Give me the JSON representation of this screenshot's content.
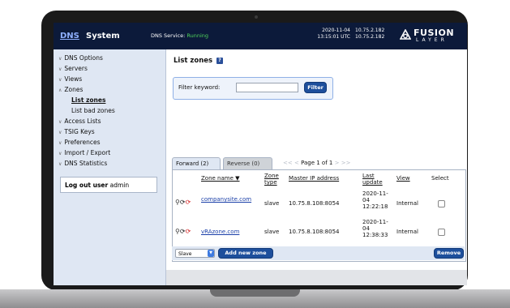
{
  "header": {
    "brand_dns": "DNS",
    "brand_system": "System",
    "service_label": "DNS Service:",
    "service_status": "Running",
    "date": "2020-11-04",
    "time": "13:15:01 UTC",
    "ip_1": "10.75.2.182",
    "ip_2": "10.75.2.182",
    "logo_word": "FUSION",
    "logo_sub": "LAYER"
  },
  "sidebar": {
    "items": [
      {
        "label": "DNS Options"
      },
      {
        "label": "Servers"
      },
      {
        "label": "Views"
      },
      {
        "label": "Zones"
      },
      {
        "label": "List zones"
      },
      {
        "label": "List bad zones"
      },
      {
        "label": "Access Lists"
      },
      {
        "label": "TSIG Keys"
      },
      {
        "label": "Preferences"
      },
      {
        "label": "Import / Export"
      },
      {
        "label": "DNS Statistics"
      }
    ],
    "logout_label": "Log out user",
    "username": "admin"
  },
  "main": {
    "title": "List zones",
    "help_glyph": "?",
    "filter": {
      "label": "Filter keyword:",
      "value": "",
      "button": "Filter"
    },
    "tabs": [
      {
        "label": "Forward (2)",
        "active": true
      },
      {
        "label": "Reverse (0)",
        "active": false
      }
    ],
    "pager": {
      "first": "<<",
      "prev": "<",
      "text": "Page 1 of 1",
      "next": ">",
      "last": ">>"
    },
    "table": {
      "headers": {
        "zone_name": "Zone name ▼",
        "zone_type_1": "Zone",
        "zone_type_2": "type",
        "master_ip": "Master IP address",
        "last_update_1": "Last",
        "last_update_2": "update",
        "view": "View",
        "select": "Select"
      },
      "rows": [
        {
          "zone": "companysite.com",
          "type": "slave",
          "master": "10.75.8.108:8054",
          "update_l1": "2020-11-",
          "update_l2": "04",
          "update_l3": "12:22:18",
          "view": "Internal"
        },
        {
          "zone": "vRAzone.com",
          "type": "slave",
          "master": "10.75.8.108:8054",
          "update_l1": "2020-11-",
          "update_l2": "04",
          "update_l3": "12:38:33",
          "view": "Internal"
        }
      ]
    },
    "zone_type_select": "Slave",
    "add_button": "Add new zone",
    "remove_button": "Remove"
  },
  "colors": {
    "topbar": "#0c1a3a",
    "sidebar": "#dfe7f3",
    "button_blue": "#1d4f9c",
    "status_green": "#4fd35a"
  }
}
